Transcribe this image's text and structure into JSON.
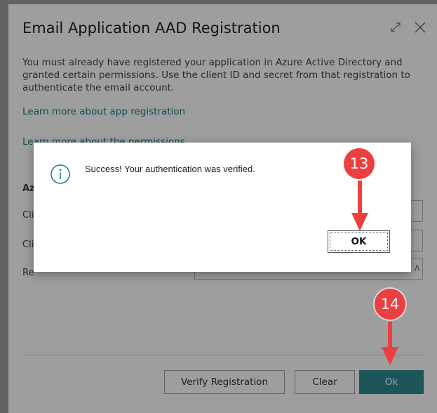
{
  "dialog": {
    "title": "Email Application AAD Registration",
    "description": "You must already have registered your application in Azure Active Directory and granted certain permissions. Use the client ID and secret from that registration to authenticate the email account.",
    "link_app_registration": "Learn more about app registration",
    "link_permissions": "Learn more about the permissions",
    "group_heading_fragment": "Az",
    "field_label_fragments": [
      "Cli",
      "Cli",
      "Re"
    ],
    "redirect_url_fragment": "/\\",
    "buttons": {
      "verify": "Verify Registration",
      "clear": "Clear",
      "ok": "Ok"
    },
    "icons": [
      "expand-icon",
      "close-icon"
    ]
  },
  "message_box": {
    "text": "Success! Your authentication was verified.",
    "ok_label": "OK",
    "icon": "info-icon"
  },
  "annotations": [
    {
      "number": "13",
      "target": "message_box.ok"
    },
    {
      "number": "14",
      "target": "dialog.buttons.ok"
    }
  ],
  "colors": {
    "accent": "#2e8b94",
    "link": "#1a7a8c",
    "annotation": "#ec4040"
  }
}
